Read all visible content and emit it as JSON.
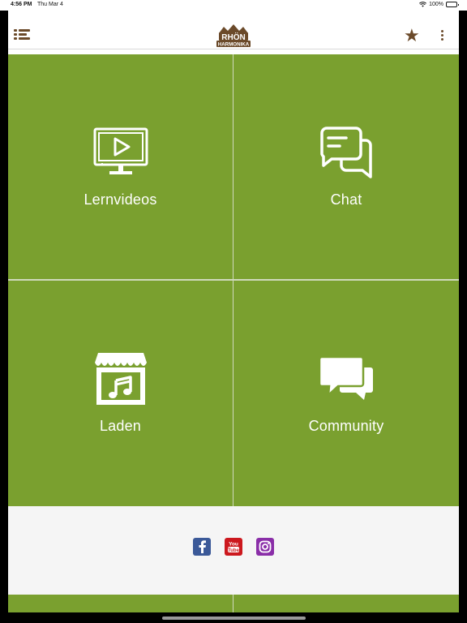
{
  "status_bar": {
    "time": "4:56 PM",
    "date": "Thu Mar 4",
    "battery": "100%",
    "wifi_icon": "wifi-icon"
  },
  "header": {
    "logo_text_top": "RHÖN",
    "logo_text_bottom": "HARMONIKA",
    "menu_icon": "menu-icon",
    "favorite_icon": "star-icon",
    "more_icon": "more-vertical-icon",
    "brand_color": "#6b4a2a"
  },
  "tiles": [
    {
      "label": "Lernvideos",
      "icon": "video-monitor-icon"
    },
    {
      "label": "Chat",
      "icon": "chat-bubbles-outline-icon"
    },
    {
      "label": "Laden",
      "icon": "music-shop-icon"
    },
    {
      "label": "Community",
      "icon": "community-chat-icon"
    }
  ],
  "tile_color": "#7aa02f",
  "social": [
    {
      "name": "facebook-icon",
      "color": "#3b5998"
    },
    {
      "name": "youtube-icon",
      "color": "#cc181e"
    },
    {
      "name": "instagram-icon",
      "color": "#8a2ea8"
    }
  ]
}
